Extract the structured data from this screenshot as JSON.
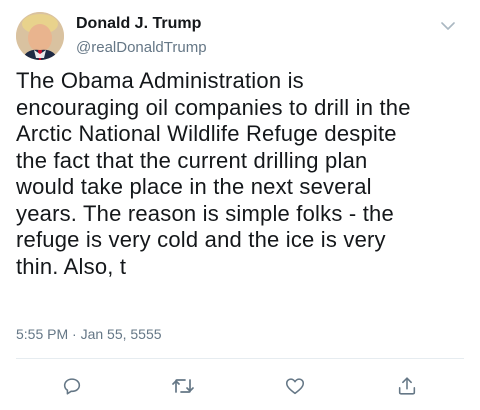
{
  "user": {
    "display_name": "Donald J. Trump",
    "handle": "@realDonaldTrump"
  },
  "tweet": {
    "text": "The Obama Administration is\nencouraging oil companies to drill in the\nArctic National Wildlife Refuge despite\nthe fact that the current drilling plan\nwould take place in the next several\nyears. The reason is simple folks - the\nrefuge is very cold and the ice is very\nthin. Also, t",
    "timestamp": "5:55 PM · Jan 55, 5555"
  },
  "icons": {
    "caret": "chevron-down-icon",
    "reply": "reply-icon",
    "retweet": "retweet-icon",
    "like": "heart-icon",
    "share": "share-icon"
  },
  "colors": {
    "text": "#14171a",
    "secondary": "#657786",
    "divider": "#e6ecf0"
  }
}
